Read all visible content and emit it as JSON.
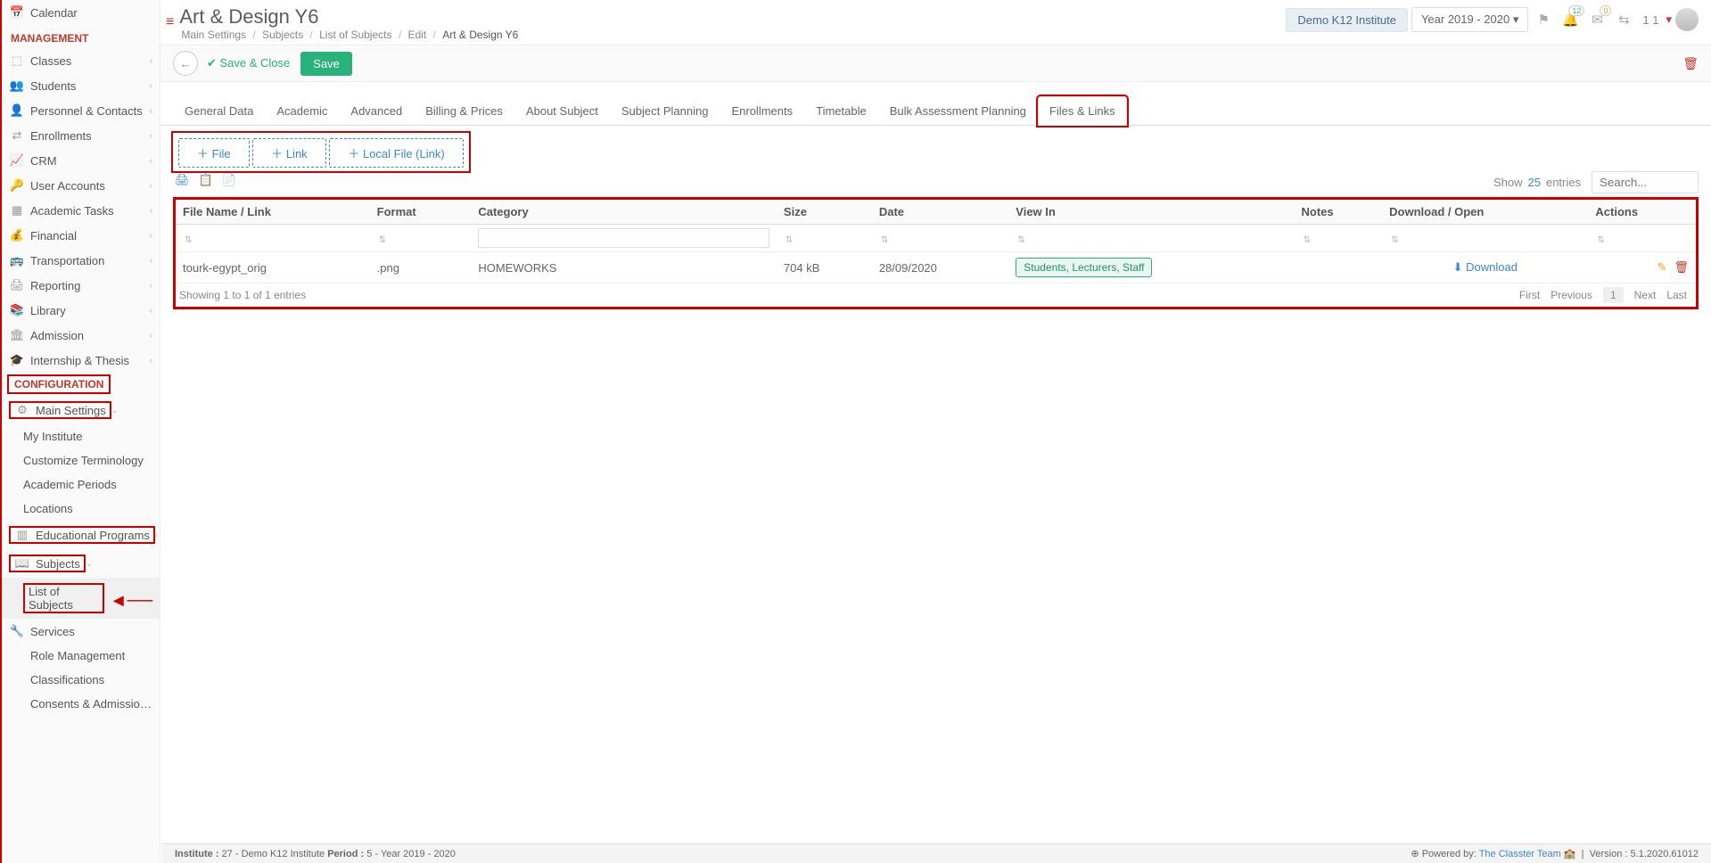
{
  "sidebar": {
    "calendar": "Calendar",
    "section_management": "MANAGEMENT",
    "management": [
      {
        "icon": "⬚",
        "label": "Classes"
      },
      {
        "icon": "👥",
        "label": "Students"
      },
      {
        "icon": "👤",
        "label": "Personnel & Contacts"
      },
      {
        "icon": "⇄",
        "label": "Enrollments"
      },
      {
        "icon": "📈",
        "label": "CRM"
      },
      {
        "icon": "🔑",
        "label": "User Accounts"
      },
      {
        "icon": "▦",
        "label": "Academic Tasks"
      },
      {
        "icon": "💰",
        "label": "Financial"
      },
      {
        "icon": "🚌",
        "label": "Transportation"
      },
      {
        "icon": "🖨",
        "label": "Reporting"
      },
      {
        "icon": "📚",
        "label": "Library"
      },
      {
        "icon": "🏛",
        "label": "Admission"
      },
      {
        "icon": "🎓",
        "label": "Internship & Thesis"
      }
    ],
    "section_config": "CONFIGURATION",
    "main_settings_label": "Main Settings",
    "main_settings_sub": [
      "My Institute",
      "Customize Terminology",
      "Academic Periods",
      "Locations"
    ],
    "edu_programs_label": "Educational Programs",
    "subjects_label": "Subjects",
    "list_of_subjects": "List of Subjects",
    "config_rest": [
      {
        "icon": "🔧",
        "label": "Services"
      },
      {
        "icon": "",
        "label": "Role Management"
      },
      {
        "icon": "",
        "label": "Classifications"
      },
      {
        "icon": "",
        "label": "Consents & Admission Data"
      }
    ]
  },
  "header": {
    "title": "Art & Design Y6",
    "breadcrumb": [
      "Main Settings",
      "Subjects",
      "List of Subjects",
      "Edit",
      "Art & Design Y6"
    ],
    "institute_btn": "Demo K12 Institute",
    "year_btn": "Year 2019 - 2020",
    "caret": "▾",
    "notif_badge": "12",
    "mail_badge": "0",
    "user_num": "1 1"
  },
  "actions": {
    "save_close": "Save & Close",
    "save": "Save"
  },
  "tabs": [
    "General Data",
    "Academic",
    "Advanced",
    "Billing & Prices",
    "About Subject",
    "Subject Planning",
    "Enrollments",
    "Timetable",
    "Bulk Assessment Planning",
    "Files & Links"
  ],
  "add_buttons": {
    "file": "File",
    "link": "Link",
    "local": "Local File (Link)"
  },
  "table": {
    "show_label": "Show",
    "show_count": "25",
    "entries_label": "entries",
    "search_placeholder": "Search...",
    "headers": [
      "File Name / Link",
      "Format",
      "Category",
      "Size",
      "Date",
      "View In",
      "Notes",
      "Download / Open",
      "Actions"
    ],
    "rows": [
      {
        "name": "tourk-egypt_orig",
        "format": ".png",
        "category": "HOMEWORKS",
        "size": "704 kB",
        "date": "28/09/2020",
        "view": "Students, Lecturers, Staff",
        "notes": "",
        "download": "Download"
      }
    ],
    "info": "Showing 1 to 1 of 1 entries",
    "pager": [
      "First",
      "Previous",
      "1",
      "Next",
      "Last"
    ]
  },
  "footer": {
    "left_institute_label": "Institute :",
    "left_institute": "27 - Demo K12 Institute",
    "left_period_label": "Period :",
    "left_period": "5 - Year 2019 - 2020",
    "powered": "Powered by:",
    "team": "The Classter Team",
    "version_label": "Version :",
    "version": "5.1.2020.61012"
  }
}
